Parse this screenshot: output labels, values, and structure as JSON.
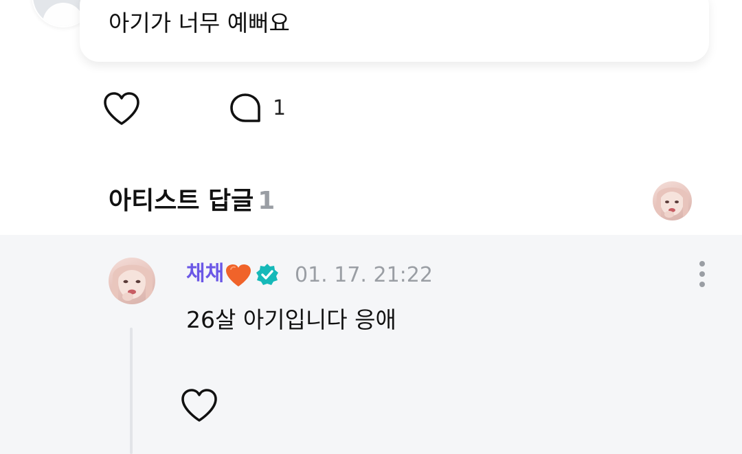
{
  "post": {
    "comment_text": "아기가 너무 예뻐요",
    "comment_count": "1",
    "icons": {
      "like": "heart-outline-icon",
      "comment": "speech-bubble-icon"
    }
  },
  "artist_replies": {
    "title": "아티스트 답글",
    "count": "1",
    "reply": {
      "author": "채채",
      "author_emoji": "orange-heart",
      "verified": true,
      "timestamp": "01. 17. 21:22",
      "text": "26살 아기입니다 응애"
    }
  },
  "colors": {
    "author_name": "#6b57e6",
    "verified_badge": "#16b9b9",
    "heart_emoji": "#f0632a",
    "muted_text": "#9a9ea4",
    "reply_background": "#f5f6f8"
  }
}
